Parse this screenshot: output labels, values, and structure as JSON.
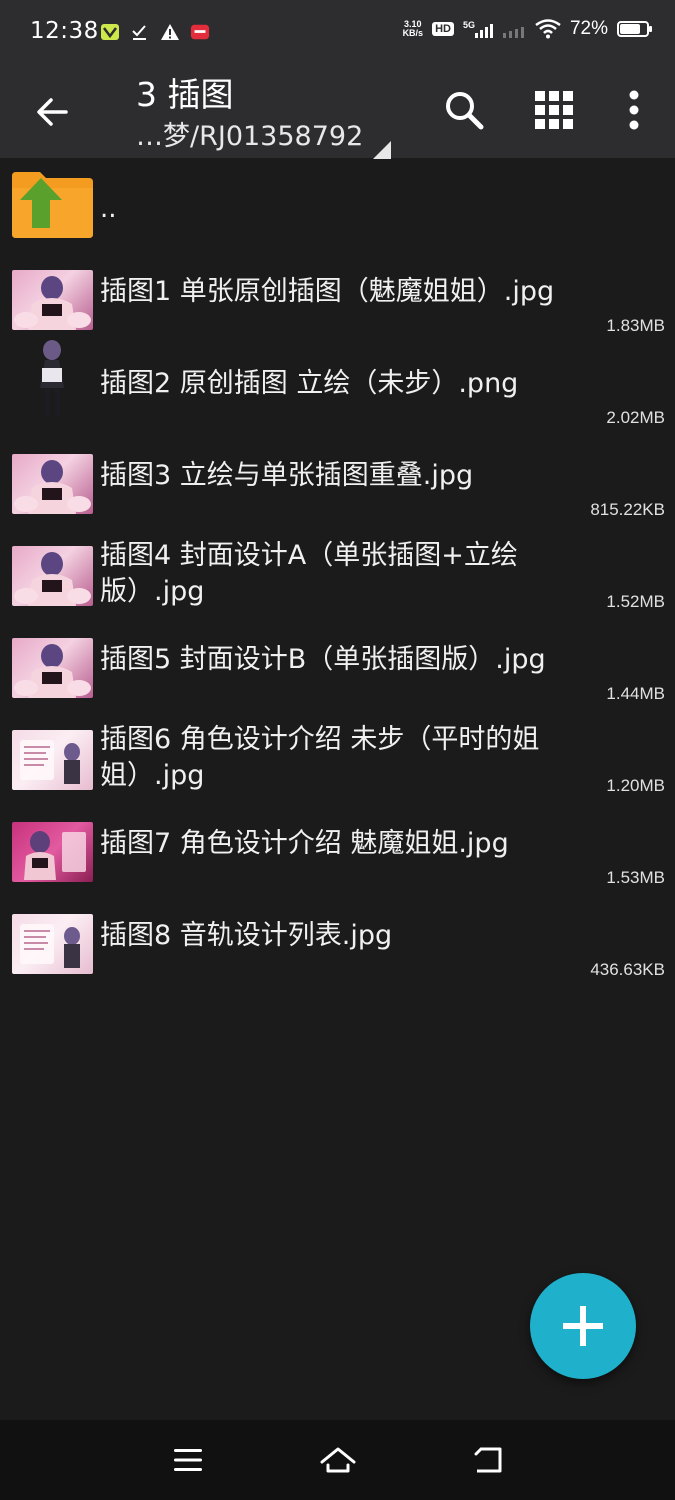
{
  "status_bar": {
    "time": "12:38",
    "net_speed_value": "3.10",
    "net_speed_unit": "KB/s",
    "hd_label": "HD",
    "network_label": "5G",
    "battery_percent": "72%",
    "battery_level": 0.72,
    "left_icons": [
      "app-notification-icon",
      "check-notification-icon",
      "warning-icon",
      "app-badge-icon"
    ]
  },
  "app_bar": {
    "title": "3 插图",
    "path": "…梦/RJ01358792",
    "actions": [
      "search-icon",
      "grid-view-icon",
      "more-vert-icon"
    ]
  },
  "file_list": {
    "parent": {
      "label": ".."
    },
    "files": [
      {
        "name": "插图1 单张原创插图（魅魔姐姐）.jpg",
        "size": "1.83MB",
        "thumb": "pink"
      },
      {
        "name": "插图2 原创插图 立绘（未步）.png",
        "size": "2.02MB",
        "thumb": "portrait"
      },
      {
        "name": "插图3 立绘与单张插图重叠.jpg",
        "size": "815.22KB",
        "thumb": "pink"
      },
      {
        "name": "插图4 封面设计A（单张插图+立绘版）.jpg",
        "size": "1.52MB",
        "thumb": "pink"
      },
      {
        "name": "插图5 封面设计B（单张插图版）.jpg",
        "size": "1.44MB",
        "thumb": "pink"
      },
      {
        "name": "插图6 角色设计介绍 未步（平时的姐姐）.jpg",
        "size": "1.20MB",
        "thumb": "light"
      },
      {
        "name": "插图7 角色设计介绍 魅魔姐姐.jpg",
        "size": "1.53MB",
        "thumb": "magenta"
      },
      {
        "name": "插图8 音轨设计列表.jpg",
        "size": "436.63KB",
        "thumb": "light"
      }
    ]
  },
  "fab": {
    "icon": "plus-icon"
  },
  "nav_bar": {
    "buttons": [
      "menu-icon",
      "home-icon",
      "back-icon"
    ]
  },
  "colors": {
    "background": "#1b1b1c",
    "app_bar": "#2d2d2f",
    "fab": "#1fb1cc",
    "folder": "#f39c1f",
    "folder_arrow": "#5aa02c"
  }
}
